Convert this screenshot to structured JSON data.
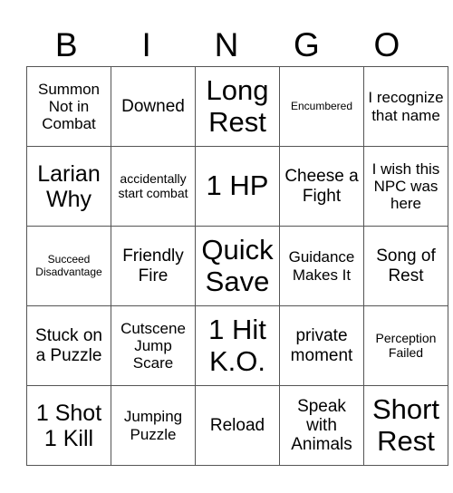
{
  "header": {
    "letters": [
      "B",
      "I",
      "N",
      "G",
      "O"
    ]
  },
  "grid": {
    "rows": [
      [
        {
          "text": "Summon Not in Combat",
          "size": "s-s"
        },
        {
          "text": "Downed",
          "size": "s-m"
        },
        {
          "text": "Long Rest",
          "size": "s-xl"
        },
        {
          "text": "Encumbered",
          "size": "s-xxs"
        },
        {
          "text": "I recognize that name",
          "size": "s-s"
        }
      ],
      [
        {
          "text": "Larian Why",
          "size": "s-l"
        },
        {
          "text": "accidentally start combat",
          "size": "s-xs"
        },
        {
          "text": "1 HP",
          "size": "s-xl"
        },
        {
          "text": "Cheese a Fight",
          "size": "s-m"
        },
        {
          "text": "I wish this NPC was here",
          "size": "s-s"
        }
      ],
      [
        {
          "text": "Succeed Disadvantage",
          "size": "s-xxs"
        },
        {
          "text": "Friendly Fire",
          "size": "s-m"
        },
        {
          "text": "Quick Save",
          "size": "s-xl"
        },
        {
          "text": "Guidance Makes It",
          "size": "s-s"
        },
        {
          "text": "Song of Rest",
          "size": "s-m"
        }
      ],
      [
        {
          "text": "Stuck on a Puzzle",
          "size": "s-m"
        },
        {
          "text": "Cutscene Jump Scare",
          "size": "s-s"
        },
        {
          "text": "1 Hit K.O.",
          "size": "s-xl"
        },
        {
          "text": "private moment",
          "size": "s-m"
        },
        {
          "text": "Perception Failed",
          "size": "s-xs"
        }
      ],
      [
        {
          "text": "1 Shot 1 Kill",
          "size": "s-l"
        },
        {
          "text": "Jumping Puzzle",
          "size": "s-s"
        },
        {
          "text": "Reload",
          "size": "s-m"
        },
        {
          "text": "Speak with Animals",
          "size": "s-m"
        },
        {
          "text": "Short Rest",
          "size": "s-xl"
        }
      ]
    ]
  }
}
